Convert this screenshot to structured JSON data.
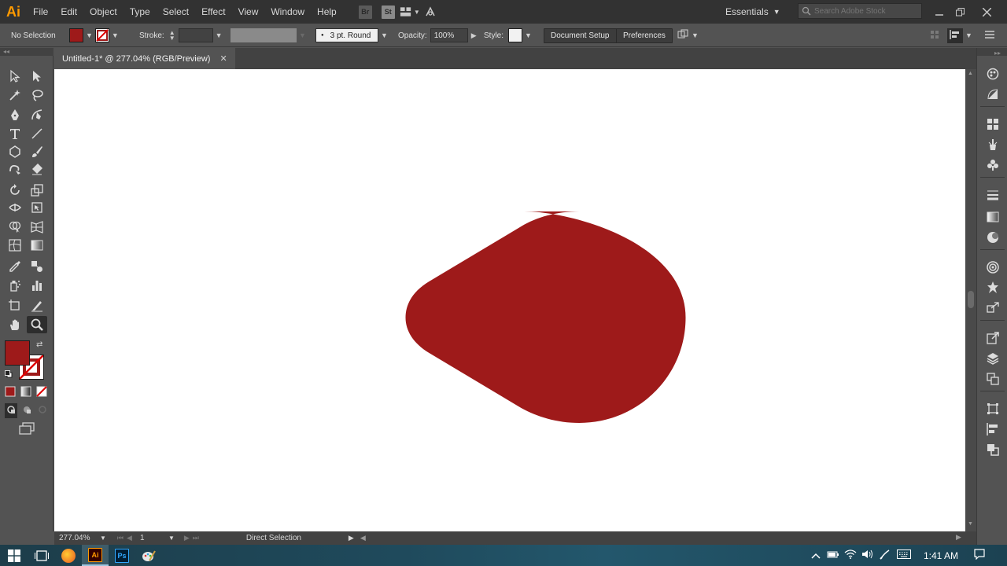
{
  "app": {
    "logo": "Ai",
    "menu": [
      "File",
      "Edit",
      "Object",
      "Type",
      "Select",
      "Effect",
      "View",
      "Window",
      "Help"
    ],
    "bridge_label": "Br",
    "stock_label": "St",
    "workspace": "Essentials",
    "search_placeholder": "Search Adobe Stock"
  },
  "control_bar": {
    "selection": "No Selection",
    "fill_color": "#9e1a1a",
    "stroke_label": "Stroke:",
    "brush": "3 pt. Round",
    "opacity_label": "Opacity:",
    "opacity_value": "100%",
    "style_label": "Style:",
    "document_setup": "Document Setup",
    "preferences": "Preferences"
  },
  "document": {
    "tab_title": "Untitled-1* @ 277.04% (RGB/Preview)",
    "close_glyph": "✕",
    "shape_color": "#9e1a1a"
  },
  "status_bar": {
    "zoom": "277.04%",
    "artboard": "1",
    "tool_status": "Direct Selection"
  },
  "tools": [
    "selection-tool",
    "direct-selection-tool",
    "magic-wand-tool",
    "lasso-tool",
    "pen-tool",
    "curvature-tool",
    "type-tool",
    "line-segment-tool",
    "polygon-tool",
    "paintbrush-tool",
    "shaper-tool",
    "eraser-tool",
    "rotate-tool",
    "scale-tool",
    "width-tool",
    "free-transform-tool",
    "shape-builder-tool",
    "perspective-grid-tool",
    "mesh-tool",
    "gradient-tool",
    "eyedropper-tool",
    "blend-tool",
    "symbol-sprayer-tool",
    "column-graph-tool",
    "artboard-tool",
    "slice-tool",
    "hand-tool",
    "zoom-tool"
  ],
  "taskbar": {
    "time": "1:41 AM",
    "ai_label": "Ai",
    "ps_label": "Ps"
  }
}
